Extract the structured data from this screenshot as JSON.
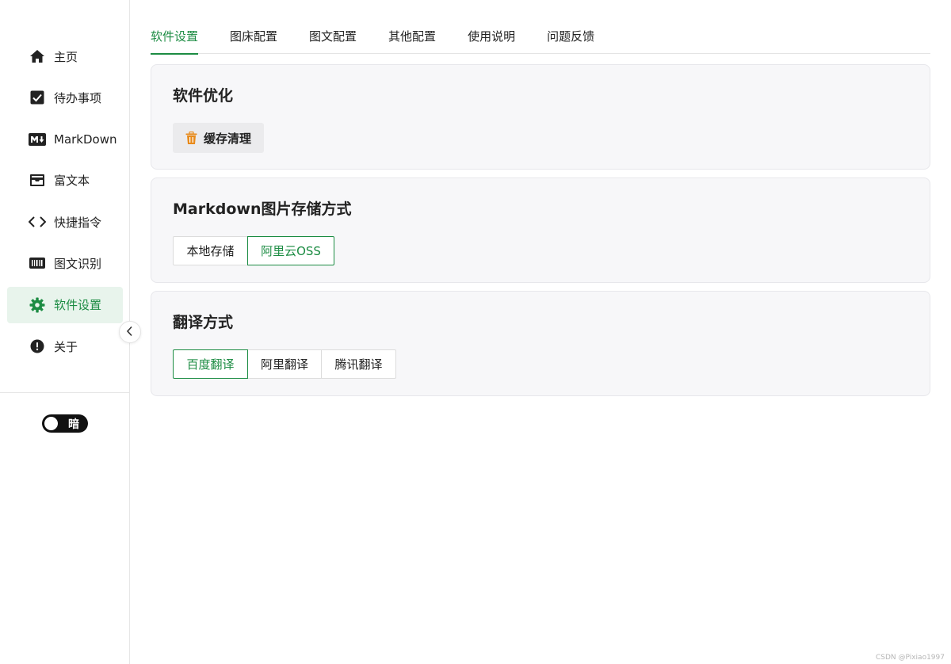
{
  "sidebar": {
    "items": [
      {
        "label": "主页",
        "icon": "home-icon",
        "active": false
      },
      {
        "label": "待办事项",
        "icon": "checkbox-icon",
        "active": false
      },
      {
        "label": "MarkDown",
        "icon": "markdown-icon",
        "active": false
      },
      {
        "label": "富文本",
        "icon": "inbox-icon",
        "active": false
      },
      {
        "label": "快捷指令",
        "icon": "code-icon",
        "active": false
      },
      {
        "label": "图文识别",
        "icon": "barcode-icon",
        "active": false
      },
      {
        "label": "软件设置",
        "icon": "gear-icon",
        "active": true
      },
      {
        "label": "关于",
        "icon": "info-icon",
        "active": false
      }
    ],
    "theme_toggle_label": "暗"
  },
  "tabs": [
    {
      "label": "软件设置",
      "active": true
    },
    {
      "label": "图床配置",
      "active": false
    },
    {
      "label": "图文配置",
      "active": false
    },
    {
      "label": "其他配置",
      "active": false
    },
    {
      "label": "使用说明",
      "active": false
    },
    {
      "label": "问题反馈",
      "active": false
    }
  ],
  "optimize": {
    "title": "软件优化",
    "clear_cache_label": "缓存清理"
  },
  "image_storage": {
    "title": "Markdown图片存储方式",
    "options": [
      {
        "label": "本地存储",
        "active": false
      },
      {
        "label": "阿里云OSS",
        "active": true
      }
    ]
  },
  "translate": {
    "title": "翻译方式",
    "options": [
      {
        "label": "百度翻译",
        "active": true
      },
      {
        "label": "阿里翻译",
        "active": false
      },
      {
        "label": "腾讯翻译",
        "active": false
      }
    ]
  },
  "watermark": "CSDN @Pixiao1997",
  "colors": {
    "accent": "#1c8c43",
    "active_bg": "#e8f4ec",
    "trash_icon": "#e88a1a"
  }
}
